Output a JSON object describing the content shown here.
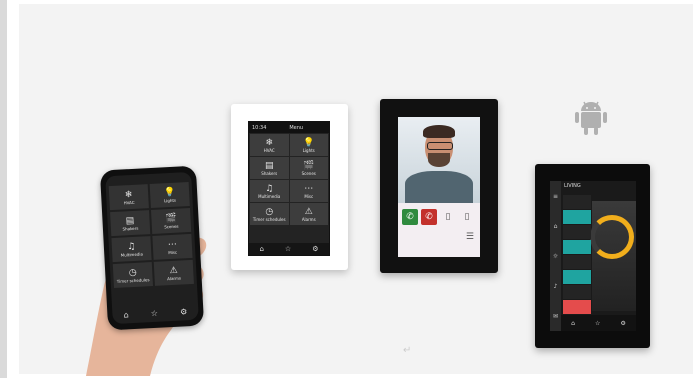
{
  "white_panel": {
    "time": "10:34",
    "title": "Menu",
    "tiles": [
      {
        "label": "HVAC",
        "icon": "hvac-icon",
        "glyph": "❄"
      },
      {
        "label": "Lights",
        "icon": "bulb-icon",
        "glyph": "💡"
      },
      {
        "label": "Shakers",
        "icon": "shutter-icon",
        "glyph": "▤"
      },
      {
        "label": "Scenes",
        "icon": "clapper-icon",
        "glyph": "🎬"
      },
      {
        "label": "Multimedia",
        "icon": "music-icon",
        "glyph": "♫"
      },
      {
        "label": "Misc",
        "icon": "ellipsis-icon",
        "glyph": "⋯"
      },
      {
        "label": "Timer schedules",
        "icon": "clock-icon",
        "glyph": "◷"
      },
      {
        "label": "Alarms",
        "icon": "alarm-icon",
        "glyph": "⚠"
      }
    ],
    "bottom_icons": [
      "home-icon",
      "star-icon",
      "settings-icon"
    ]
  },
  "phone": {
    "tiles": [
      {
        "label": "HVAC",
        "icon": "hvac-icon",
        "glyph": "❄"
      },
      {
        "label": "Lights",
        "icon": "bulb-icon",
        "glyph": "💡"
      },
      {
        "label": "Shakers",
        "icon": "shutter-icon",
        "glyph": "▤"
      },
      {
        "label": "Scenes",
        "icon": "clapper-icon",
        "glyph": "🎬"
      },
      {
        "label": "Multimedia",
        "icon": "music-icon",
        "glyph": "♫"
      },
      {
        "label": "Misc",
        "icon": "ellipsis-icon",
        "glyph": "⋯"
      },
      {
        "label": "Timer schedules",
        "icon": "clock-icon",
        "glyph": "◷"
      },
      {
        "label": "Alarms",
        "icon": "alarm-icon",
        "glyph": "⚠"
      }
    ]
  },
  "black_panel": {
    "title": "LIVING",
    "sidebar_glyphs": [
      "≡",
      "⌂",
      "☼",
      "♪",
      "✉"
    ]
  },
  "colors": {
    "accent_teal": "#1fa4a0",
    "accent_orange": "#f1ae1c",
    "call_green": "#2f8a3e",
    "call_red": "#c3312c"
  }
}
